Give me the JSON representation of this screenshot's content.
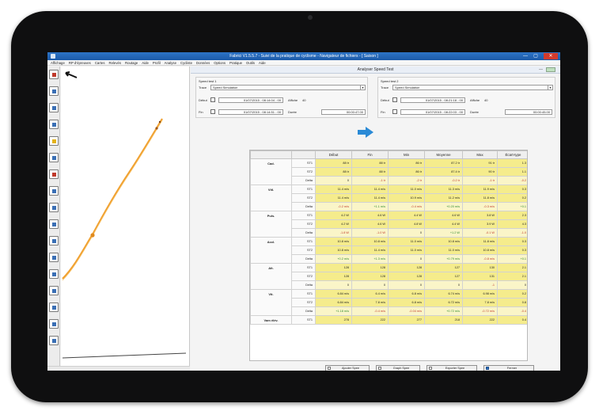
{
  "window": {
    "title": "Fabrici V1.5.5.7 - Suivi de la pratique de cyclisme - Navigateur de fichiers - [ Saison ]",
    "minimize": "—",
    "maximize": "▢",
    "close": "✕"
  },
  "menu": [
    "Affichage",
    "RP d'épreuves",
    "Cartes",
    "Relevés",
    "Routage",
    "Aide",
    "Profil",
    "Analyse",
    "Cycliste",
    "Données",
    "Options",
    "Pratique",
    "Outils",
    "Aide"
  ],
  "left_tools": [
    "cursor-icon",
    "zoom-icon",
    "ruler-icon",
    "grid-icon",
    "map-icon",
    "layers-icon",
    "flag-icon",
    "chart-icon",
    "bike-icon",
    "route-icon",
    "cloud-icon",
    "marker-icon",
    "wave-icon",
    "disk-icon",
    "gear-icon",
    "globe-icon",
    "info-icon"
  ],
  "panel": {
    "title": "Analyser Speed Test",
    "speed_test_1": {
      "label": "Speed test 1",
      "trace_label": "Trace",
      "trace_value": "Speed Simulation",
      "start_label": "Début",
      "start_value": "01/07/2015 - 08:14:04 - 00",
      "end_label": "Fin",
      "end_value": "01/07/2015 - 08:14:51 - 00",
      "affiche_label": "Affiche",
      "affiche_value": "40",
      "duree_label": "Durée",
      "duree_value": "00:00:47.00"
    },
    "speed_test_2": {
      "label": "Speed test 2",
      "trace_label": "Trace",
      "trace_value": "Speed Simulation",
      "start_label": "Début",
      "start_value": "01/07/2015 - 08:21:18 - 00",
      "end_label": "Fin",
      "end_value": "01/07/2015 - 08:22:03 - 00",
      "affiche_label": "Affiche",
      "affiche_value": "40",
      "duree_label": "Durée",
      "duree_value": "00:00:45.00"
    },
    "table": {
      "columns": [
        "",
        "",
        "Début",
        "Fin",
        "Min",
        "Moyenne",
        "Max",
        "Écart-type"
      ],
      "groups": [
        {
          "name": "Cad.",
          "rows": [
            {
              "label": "ST1",
              "cells": [
                "88 tr",
                "88 tr",
                "86 tr",
                "87.2 tr",
                "91 tr",
                "1.3"
              ]
            },
            {
              "label": "ST2",
              "cells": [
                "88 tr",
                "88 tr",
                "86 tr",
                "87.4 tr",
                "90 tr",
                "1.1"
              ]
            },
            {
              "label": "Delta",
              "cells": [
                "0",
                "-1 tr",
                "-2 tr",
                "-0.2 tr",
                "-1 tr",
                "-0.2"
              ]
            }
          ]
        },
        {
          "name": "Vitl.",
          "rows": [
            {
              "label": "ST1",
              "cells": [
                "11.4 m/s",
                "11.4 m/s",
                "11.0 m/s",
                "11.3 m/s",
                "11.9 m/s",
                "0.3"
              ]
            },
            {
              "label": "ST2",
              "cells": [
                "11.4 m/s",
                "11.4 m/s",
                "10.9 m/s",
                "11.2 m/s",
                "11.8 m/s",
                "0.2"
              ]
            },
            {
              "label": "Delta",
              "cells": [
                "-0.2 m/s",
                "+1.1 m/s",
                "-0.4 m/s",
                "+0.20 m/s",
                "-0.3 m/s",
                "+0.1"
              ]
            }
          ]
        },
        {
          "name": "Puis.",
          "rows": [
            {
              "label": "ST1",
              "cells": [
                "4.2 W",
                "4.6 W",
                "4.4 W",
                "4.6 W",
                "3.8 W",
                "2.3"
              ]
            },
            {
              "label": "ST2",
              "cells": [
                "4.2 W",
                "4.6 W",
                "4.8 W",
                "4.4 W",
                "3.9 W",
                "4.3"
              ]
            },
            {
              "label": "Delta",
              "cells": [
                "-1.8 W",
                "-1.0 W",
                "0",
                "+1.2 W",
                "-0.1 W",
                "-1.0"
              ]
            }
          ]
        },
        {
          "name": "Accl.",
          "rows": [
            {
              "label": "ST1",
              "cells": [
                "10.8 m/s",
                "10.8 m/s",
                "11.0 m/s",
                "10.8 m/s",
                "11.8 m/s",
                "0.3"
              ]
            },
            {
              "label": "ST2",
              "cells": [
                "10.8 m/s",
                "11.4 m/s",
                "11.0 m/s",
                "11.0 m/s",
                "10.8 m/s",
                "0.3"
              ]
            },
            {
              "label": "Delta",
              "cells": [
                "+0.2 m/s",
                "+1.3 m/s",
                "0",
                "+0.79 m/s",
                "-0.8 m/s",
                "+0.1"
              ]
            }
          ]
        },
        {
          "name": "Alt.",
          "rows": [
            {
              "label": "ST1",
              "cells": [
                "128",
                "128",
                "128",
                "127",
                "130",
                "2.1"
              ]
            },
            {
              "label": "ST2",
              "cells": [
                "128",
                "128",
                "128",
                "127",
                "131",
                "2.1"
              ]
            },
            {
              "label": "Delta",
              "cells": [
                "0",
                "0",
                "0",
                "0",
                "-1",
                "0"
              ]
            }
          ]
        },
        {
          "name": "Vit.",
          "rows": [
            {
              "label": "ST1",
              "cells": [
                "6.84 m/s",
                "6.4 m/s",
                "6.8 m/s",
                "6.74 m/s",
                "6.98 m/s",
                "0.2"
              ]
            },
            {
              "label": "ST2",
              "cells": [
                "6.84 m/s",
                "7.8 m/s",
                "6.8 m/s",
                "6.72 m/s",
                "7.8 m/s",
                "0.8"
              ]
            },
            {
              "label": "Delta",
              "cells": [
                "+1.18 m/s",
                "-0.4 m/s",
                "-0.04 m/s",
                "+0.72 m/s",
                "-0.72 m/s",
                "-0.4"
              ]
            }
          ]
        },
        {
          "name": "Vam élév.",
          "rows": [
            {
              "label": "ST1",
              "cells": [
                "278",
                "222",
                "277",
                "218",
                "222",
                "0.4"
              ]
            }
          ]
        }
      ]
    },
    "buttons": [
      {
        "icon": "table-icon",
        "label": "Ajouter Spee"
      },
      {
        "icon": "graph-icon",
        "label": "Graph Spee"
      },
      {
        "icon": "export-icon",
        "label": "Exporter Spee"
      },
      {
        "icon": "close-icon",
        "label": "Fermer"
      }
    ]
  },
  "colors": {
    "titlebar": "#1c5aa8",
    "highlight": "#f5ec8c",
    "trace": "#f0a030",
    "arrow_blue": "#2a8ad6"
  }
}
